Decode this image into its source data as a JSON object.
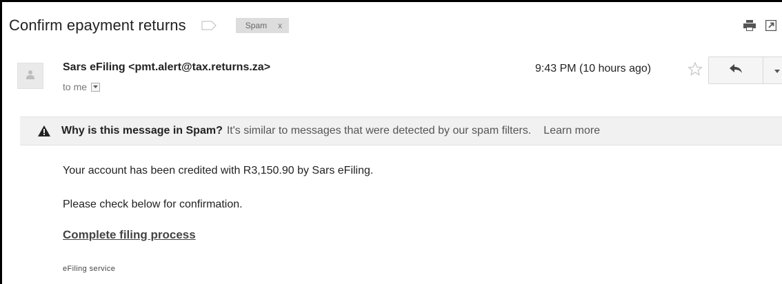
{
  "header": {
    "subject": "Confirm epayment returns",
    "spam_chip": "Spam",
    "spam_chip_close": "x"
  },
  "message": {
    "sender": "Sars eFiling <pmt.alert@tax.returns.za>",
    "recipient": "to me",
    "timestamp": "9:43 PM (10 hours ago)"
  },
  "spam_warning": {
    "question": "Why is this message in Spam?",
    "explanation": "It's similar to messages that were detected by our spam filters.",
    "learn_more": "Learn more"
  },
  "body": {
    "line1": "Your account has been credited with R3,150.90 by Sars eFiling.",
    "line2": "Please check below for confirmation.",
    "link_text": "Complete filing process",
    "signature": "eFiling service"
  },
  "icons": {
    "label": "label-outline-icon",
    "print": "print-icon",
    "new_window": "new-window-icon",
    "avatar": "person-icon",
    "star": "star-icon",
    "reply": "reply-icon",
    "more": "chevron-down-icon",
    "warning": "warning-icon"
  },
  "colors": {
    "chip_bg": "#dddddd",
    "warning_bar_bg": "#f1f1f1",
    "text": "#222222",
    "muted": "#777777"
  }
}
